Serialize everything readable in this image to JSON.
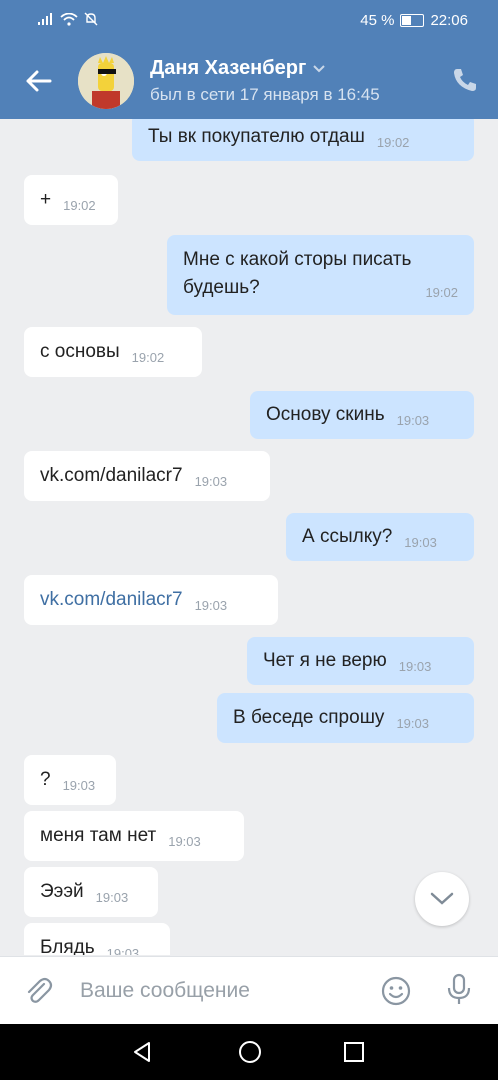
{
  "status_bar": {
    "battery": "45 %",
    "time": "22:06"
  },
  "header": {
    "name": "Даня Хазенберг",
    "last_seen": "был в сети 17 января в 16:45"
  },
  "messages": [
    {
      "dir": "out",
      "text": "Ты вк покупателю отдаш",
      "time": "19:02"
    },
    {
      "dir": "in",
      "text": "+",
      "time": "19:02"
    },
    {
      "dir": "out",
      "text": "Мне с какой сторы писать",
      "text2": "будешь?",
      "time": "19:02"
    },
    {
      "dir": "in",
      "text": "с основы",
      "time": "19:02"
    },
    {
      "dir": "out",
      "text": "Основу скинь",
      "time": "19:03"
    },
    {
      "dir": "in",
      "text": "vk.com/danilacr7",
      "time": "19:03"
    },
    {
      "dir": "out",
      "text": "А ссылку?",
      "time": "19:03"
    },
    {
      "dir": "in",
      "text": "vk.com/danilacr7",
      "time": "19:03",
      "link": true
    },
    {
      "dir": "out",
      "text": "Чет я не верю",
      "time": "19:03"
    },
    {
      "dir": "out",
      "text": "В беседе спрошу",
      "time": "19:03"
    },
    {
      "dir": "in",
      "text": "?",
      "time": "19:03"
    },
    {
      "dir": "in",
      "text": "меня там нет",
      "time": "19:03"
    },
    {
      "dir": "in",
      "text": "Эээй",
      "time": "19:03"
    },
    {
      "dir": "in",
      "text": "Блядь",
      "time": "19:03"
    }
  ],
  "composer": {
    "placeholder": "Ваше сообщение"
  },
  "colors": {
    "header": "#5181b8",
    "outgoing": "#cce4ff",
    "incoming": "#ffffff",
    "background": "#edeef0"
  }
}
